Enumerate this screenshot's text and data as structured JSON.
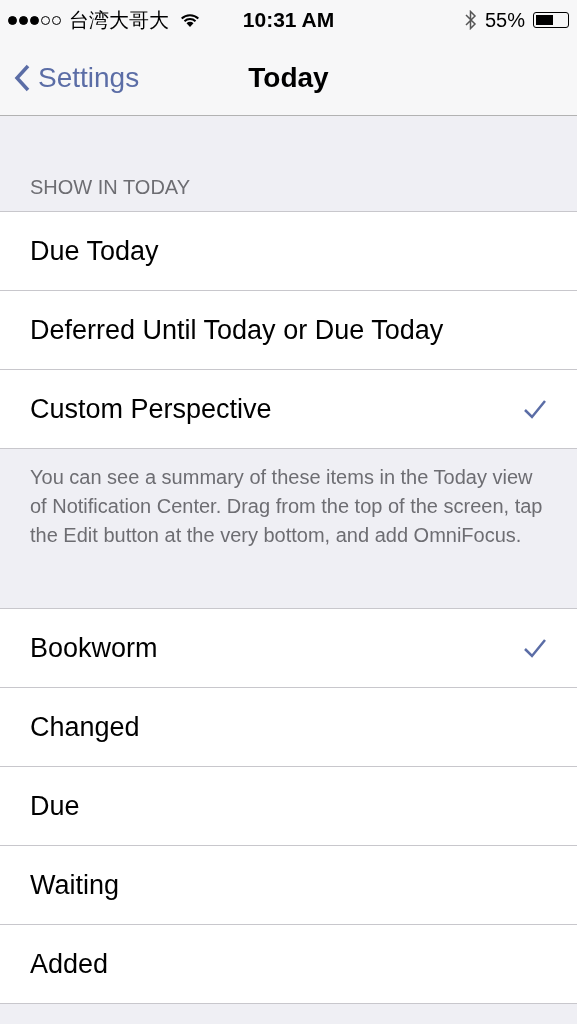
{
  "status_bar": {
    "signal_dots": [
      {
        "on": true
      },
      {
        "on": true
      },
      {
        "on": true
      },
      {
        "on": false
      },
      {
        "on": false
      }
    ],
    "carrier": "台湾大哥大",
    "time": "10:31 AM",
    "battery_text": "55%"
  },
  "nav": {
    "back": "Settings",
    "title": "Today"
  },
  "sections": [
    {
      "header": "SHOW IN TODAY",
      "items": [
        {
          "label": "Due Today",
          "selected": false
        },
        {
          "label": "Deferred Until Today or Due Today",
          "selected": false
        },
        {
          "label": "Custom Perspective",
          "selected": true
        }
      ],
      "footer": "You can see a summary of these items in the Today view of Notification Center. Drag from the top of the screen, tap the Edit button at the very bottom, and add OmniFocus."
    },
    {
      "items": [
        {
          "label": "Bookworm",
          "selected": true
        },
        {
          "label": "Changed",
          "selected": false
        },
        {
          "label": "Due",
          "selected": false
        },
        {
          "label": "Waiting",
          "selected": false
        },
        {
          "label": "Added",
          "selected": false
        }
      ]
    }
  ]
}
